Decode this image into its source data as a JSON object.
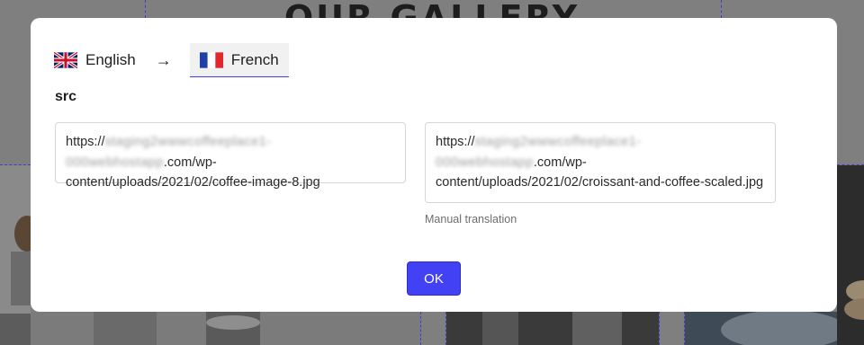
{
  "background": {
    "heading": "OUR GALLERY"
  },
  "modal": {
    "source_language": {
      "label": "English",
      "flag": "uk-flag-icon"
    },
    "arrow": "→",
    "target_language": {
      "label": "French",
      "flag": "france-flag-icon"
    },
    "attribute_label": "src",
    "source_field": {
      "prefix": "https://",
      "blurred": "staging2wwwcoffeeplace1-000webhostapp",
      "suffix": ".com/wp-content/uploads/2021/02/coffee-image-8.jpg"
    },
    "target_field": {
      "prefix": "https://",
      "blurred": "staging2wwwcoffeeplace1-000webhostapp",
      "suffix": ".com/wp-content/uploads/2021/02/croissant-and-coffee-scaled.jpg"
    },
    "hint": "Manual translation",
    "ok_label": "OK"
  },
  "colors": {
    "accent": "#4242f4",
    "overlay": "#7f7f7f",
    "dashed_guides": "#3c3ccf"
  }
}
